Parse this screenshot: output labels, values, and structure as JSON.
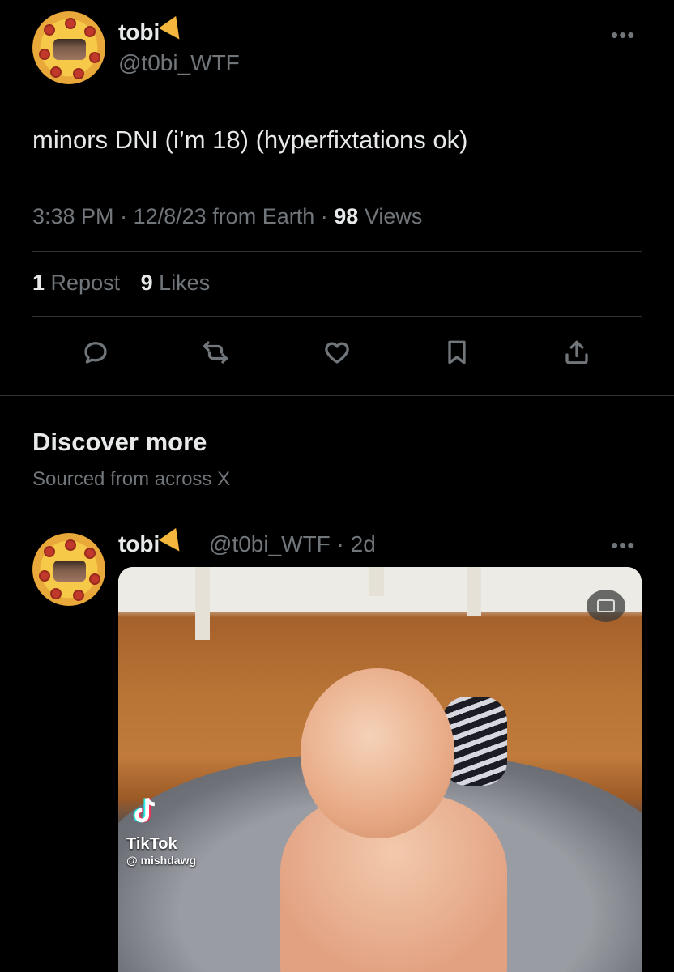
{
  "post": {
    "author_name": "tobi",
    "author_handle": "@t0bi_WTF",
    "more_label": "•••",
    "text": "minors DNI (i’m 18) (hyperfixtations ok)",
    "time": "3:38 PM",
    "date": "12/8/23",
    "source": "from Earth",
    "views_count": "98",
    "views_label": "Views",
    "reposts_count": "1",
    "reposts_label": "Repost",
    "likes_count": "9",
    "likes_label": "Likes"
  },
  "discover": {
    "title": "Discover more",
    "subtitle": "Sourced from across X"
  },
  "recommended_post": {
    "author_name": "tobi",
    "author_handle": "@t0bi_WTF",
    "age": "2d",
    "more_label": "•••",
    "video_watermark_brand": "TikTok",
    "video_watermark_user": "@ mishdawg"
  },
  "colors": {
    "background": "#000000",
    "text_primary": "#e7e9ea",
    "text_secondary": "#71767b",
    "divider": "#2f3336"
  },
  "icons": [
    "reply-icon",
    "repost-icon",
    "like-icon",
    "bookmark-icon",
    "share-icon",
    "captions-icon",
    "tiktok-icon",
    "pizza-emoji"
  ]
}
